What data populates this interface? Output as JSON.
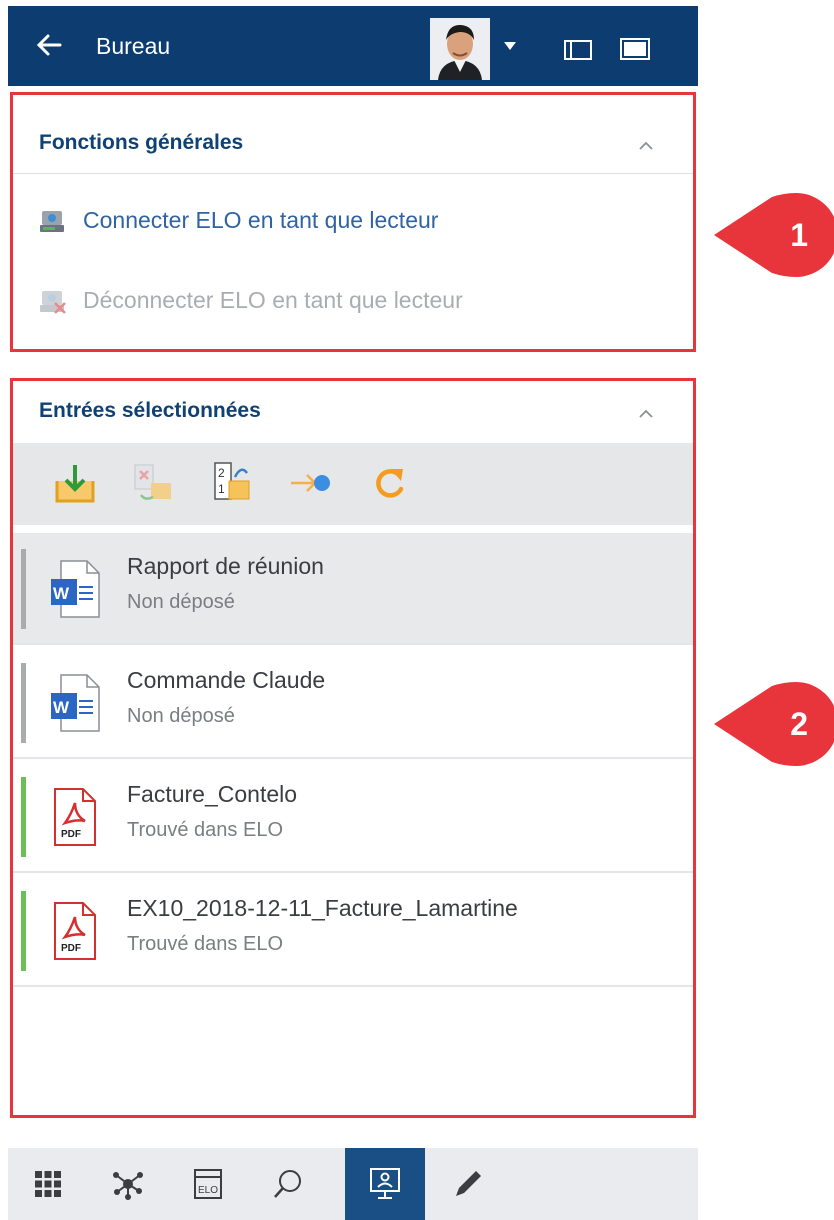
{
  "header": {
    "title": "Bureau",
    "accent_color": "#0d3d70"
  },
  "general_functions": {
    "title": "Fonctions générales",
    "actions": [
      {
        "label": "Connecter ELO en tant que lecteur",
        "icon": "connect-drive-icon",
        "enabled": true
      },
      {
        "label": "Déconnecter ELO en tant que lecteur",
        "icon": "disconnect-drive-icon",
        "enabled": false
      }
    ]
  },
  "selected_entries": {
    "title": "Entrées sélectionnées",
    "toolbar": [
      {
        "icon": "file-in-icon",
        "enabled": true
      },
      {
        "icon": "replace-file-icon",
        "enabled": false
      },
      {
        "icon": "sort-order-icon",
        "enabled": true
      },
      {
        "icon": "send-to-icon",
        "enabled": true
      },
      {
        "icon": "refresh-icon",
        "enabled": true
      }
    ],
    "items": [
      {
        "name": "Rapport de réunion",
        "status": "Non déposé",
        "type": "word",
        "status_color": "#a9abad",
        "selected": true
      },
      {
        "name": "Commande Claude",
        "status": "Non déposé",
        "type": "word",
        "status_color": "#a9abad",
        "selected": false
      },
      {
        "name": "Facture_Contelo",
        "status": "Trouvé dans ELO",
        "type": "pdf",
        "status_color": "#6bbf59",
        "selected": false
      },
      {
        "name": "EX10_2018-12-11_Facture_Lamartine",
        "status": "Trouvé dans ELO",
        "type": "pdf",
        "status_color": "#6bbf59",
        "selected": false
      }
    ],
    "pdf_badge": "PDF"
  },
  "callouts": [
    "1",
    "2"
  ],
  "bottom_nav": [
    {
      "icon": "tiles-icon",
      "active": false
    },
    {
      "icon": "network-icon",
      "active": false
    },
    {
      "icon": "elo-repository-icon",
      "label": "ELO",
      "active": false
    },
    {
      "icon": "search-icon",
      "active": false
    },
    {
      "icon": "desktop-icon",
      "active": true
    },
    {
      "icon": "pen-icon",
      "active": false
    }
  ],
  "highlight_color": "#e8343b"
}
